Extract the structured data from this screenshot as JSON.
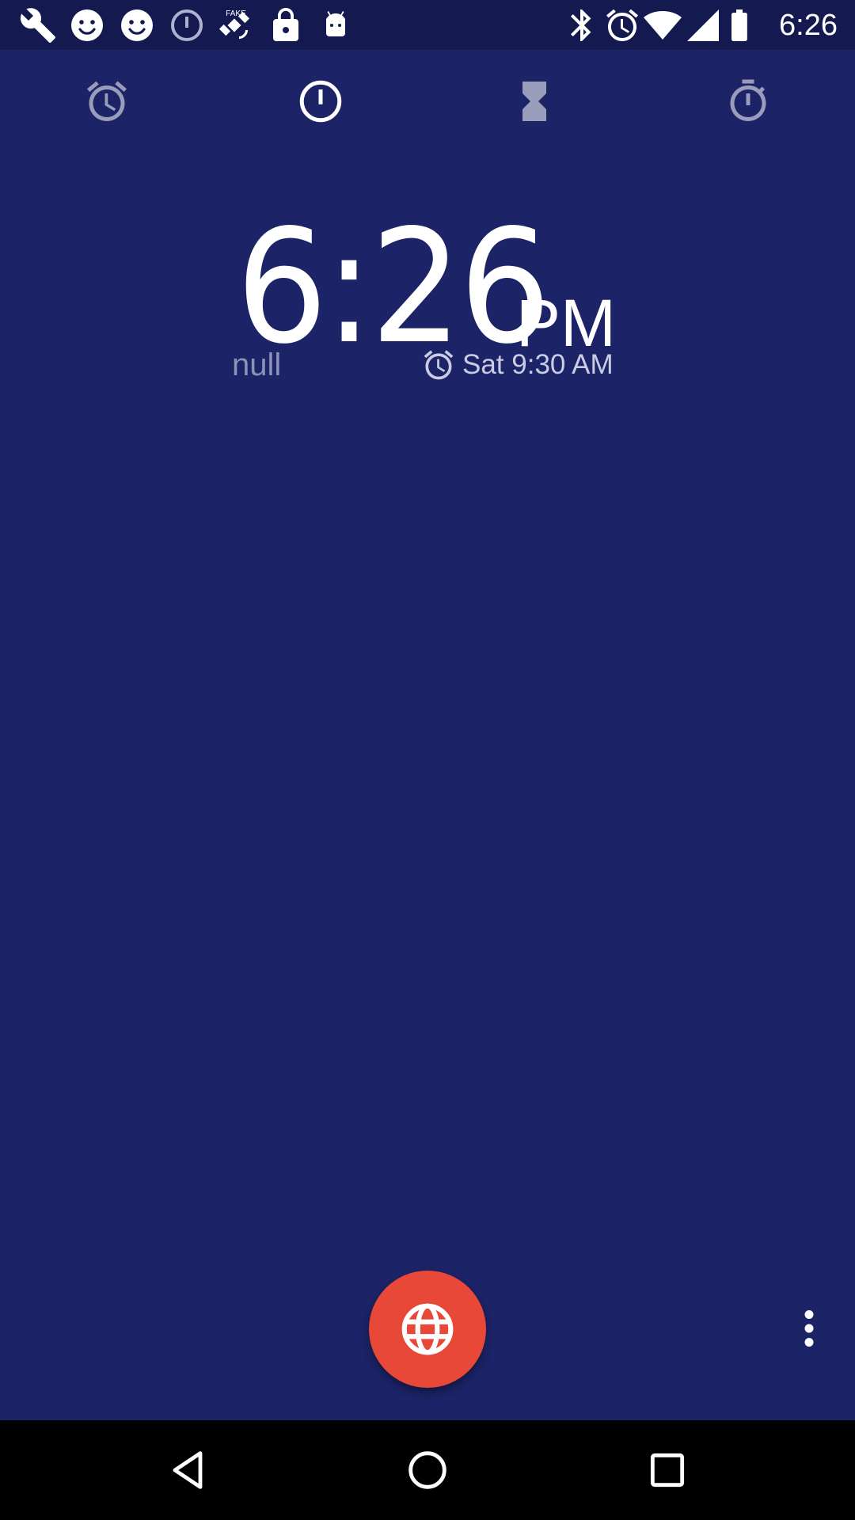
{
  "status_bar": {
    "time": "6:26",
    "left_icons": [
      "wrench-icon",
      "smiley-icon",
      "smiley-icon",
      "alarm-info-icon",
      "fake-gps-icon",
      "lock-icon",
      "android-icon"
    ],
    "right_icons": [
      "bluetooth-icon",
      "alarm-status-icon",
      "wifi-icon",
      "signal-icon",
      "battery-icon"
    ]
  },
  "tabs": [
    {
      "id": "alarm",
      "icon": "alarm-icon"
    },
    {
      "id": "clock",
      "icon": "clock-icon"
    },
    {
      "id": "timer",
      "icon": "hourglass-icon"
    },
    {
      "id": "stopwatch",
      "icon": "stopwatch-icon"
    }
  ],
  "clock": {
    "time": "6:26",
    "ampm": "PM",
    "date_label": "null",
    "next_alarm": "Sat 9:30 AM"
  },
  "colors": {
    "background": "#1c2366",
    "status_bar": "#141a4f",
    "fab": "#e84837",
    "nav_bar": "#000000"
  },
  "fab": {
    "icon": "globe-icon"
  },
  "overflow": {
    "icon": "more-vert-icon"
  },
  "nav": {
    "back_icon": "back-icon",
    "home_icon": "home-icon",
    "recents_icon": "recents-icon"
  }
}
